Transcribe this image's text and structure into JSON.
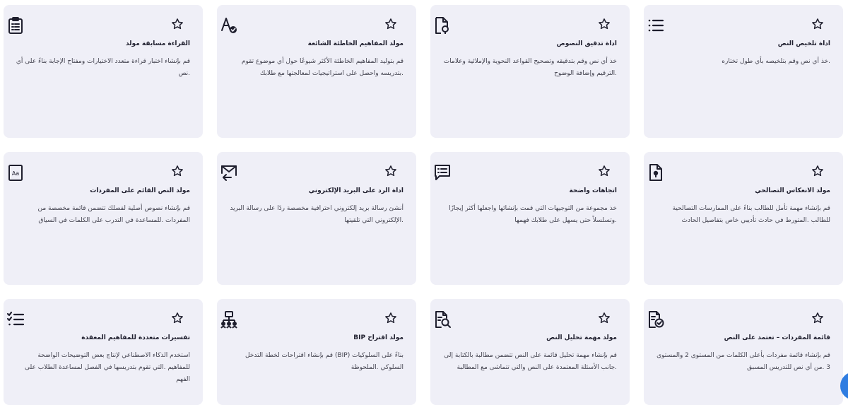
{
  "cards": [
    {
      "title": "أداة تلخيص النص",
      "desc": ".خذ أي نص وقم بتلخيصه بأي طول تختاره",
      "icon": "list-icon"
    },
    {
      "title": "أداة تدقيق النصوص",
      "desc": "خذ أي نص وقم بتدقيقه وتصحيح القواعد النحوية والإملائية وعلامات .الترقيم وإضافة الوضوح",
      "icon": "document-search-icon"
    },
    {
      "title": "مولد المفاهيم الخاطئة الشائعة",
      "desc": "قم بتوليد المفاهيم الخاطئة الأكثر شيوعًا حول أي موضوع تقوم .بتدريسه واحصل على استراتيجيات لمعالجتها مع طلابك",
      "icon": "spellcheck-icon"
    },
    {
      "title": "القراءة مسابقة مولد",
      "desc": "قم بإنشاء اختبار قراءة متعدد الاختيارات ومفتاح الإجابة بناءً على أي .نص",
      "icon": "clipboard-list-icon"
    },
    {
      "title": "مولد الانعكاس التصالحي",
      "desc": "قم بإنشاء مهمة تأمل للطالب بناءً على الممارسات التصالحية للطالب .المتورط في حادث تأديبي خاص بتفاصيل الحادث",
      "icon": "document-idea-icon"
    },
    {
      "title": "اتجاهات واضحة",
      "desc": "خذ مجموعة من التوجيهات التي قمت بإنشائها واجعلها أكثر إيجازًا .وتسلسلاً حتى يسهل على طلابك فهمها",
      "icon": "message-list-icon"
    },
    {
      "title": "أداة الرد على البريد الإلكتروني",
      "desc": "أنشئ رسالة بريد إلكتروني احترافية مخصصة ردًا على رسالة البريد .الإلكتروني التي تلقيتها",
      "icon": "mail-reply-icon"
    },
    {
      "title": "مولد النص القائم على المفردات",
      "desc": "قم بإنشاء نصوص أصلية لفصلك تتضمن قائمة مخصصة من المفردات .للمساعدة في التدرب على الكلمات في السياق",
      "icon": "text-box-icon"
    },
    {
      "title": "قائمة المفردات – تعتمد على النص",
      "desc": "قم بإنشاء قائمة مفردات بأعلى الكلمات من المستوى 2 والمستوى 3 .من أي نص للتدريس المسبق",
      "icon": "document-check-icon"
    },
    {
      "title": "مولد مهمة تحليل النص",
      "desc": "قم بإنشاء مهمة تحليل قائمة على النص تتضمن مطالبة بالكتابة إلى .جانب الأسئلة المعتمدة على النص والتي تتماشى مع المطالبة",
      "icon": "document-magnify-icon"
    },
    {
      "title": "مولد اقتراح BIP",
      "desc": "بناءً على السلوكيات (BIP) قم بإنشاء اقتراحات لخطة التدخل السلوكي .الملحوظة",
      "icon": "org-chart-icon"
    },
    {
      "title": "تفسيرات متعددة للمفاهيم المعقدة",
      "desc": "استخدم الذكاء الاصطناعي لإنتاج بعض التوضيحات الواضحة للمفاهيم .التي تقوم بتدريسها في الفصل لمساعدة الطلاب على الفهم",
      "icon": "checklist-icon"
    }
  ],
  "favorite_icon": "star-outline-icon",
  "fab_icon": "chat-bubble-icon",
  "colors": {
    "card_bg": "#efeff7",
    "icon": "#1f1f2e",
    "fab": "#2f7de1"
  }
}
